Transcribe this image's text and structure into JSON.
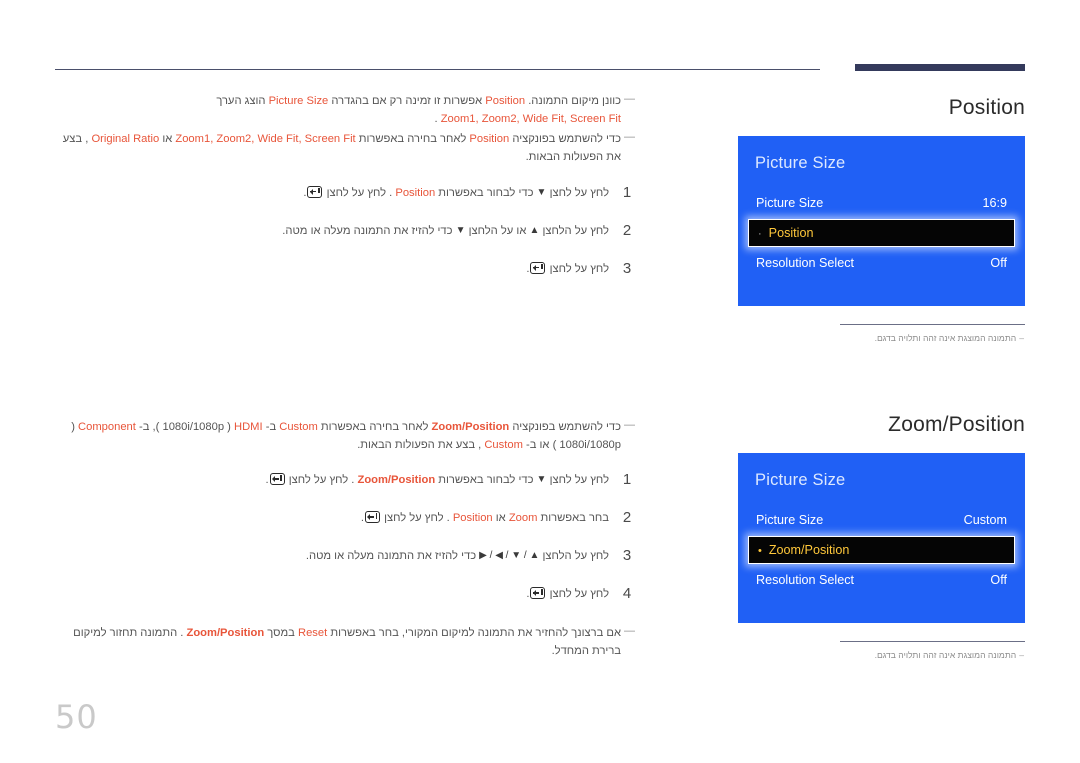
{
  "page": {
    "number": "50"
  },
  "sections": [
    {
      "id": "position",
      "notes": [
        {
          "dash": "—",
          "parts": [
            {
              "t": "כוונן מיקום התמונה.",
              "style": "plain"
            },
            {
              "t": "Position",
              "style": "hl"
            },
            {
              "t": "אפשרות זו זמינה רק אם בהגדרה",
              "style": "plain"
            },
            {
              "t": "Picture Size",
              "style": "hl"
            },
            {
              "t": "הוצג הערך",
              "style": "plain"
            },
            {
              "t": "Zoom1, Zoom2, Wide Fit, Screen Fit",
              "style": "hl"
            },
            {
              "t": ".",
              "style": "plain"
            }
          ]
        },
        {
          "dash": "—",
          "parts": [
            {
              "t": "כדי להשתמש בפונקציה",
              "style": "plain"
            },
            {
              "t": "Position",
              "style": "hl"
            },
            {
              "t": "לאחר בחירה באפשרות",
              "style": "plain"
            },
            {
              "t": "Zoom1, Zoom2, Wide Fit, Screen Fit",
              "style": "hl"
            },
            {
              "t": "או",
              "style": "plain"
            },
            {
              "t": "Original Ratio",
              "style": "hl"
            },
            {
              "t": ", בצע את הפעולות הבאות.",
              "style": "plain"
            }
          ]
        }
      ],
      "steps": [
        {
          "num": "1",
          "parts": [
            {
              "t": "לחץ על לחצן",
              "style": "plain"
            },
            {
              "t": "▼",
              "style": "tri"
            },
            {
              "t": "כדי לבחור באפשרות",
              "style": "plain"
            },
            {
              "t": "Position",
              "style": "hl"
            },
            {
              "t": ". לחץ על לחצן",
              "style": "plain"
            },
            {
              "t": "enter-key",
              "style": "key"
            },
            {
              "t": ".",
              "style": "plain"
            }
          ]
        },
        {
          "num": "2",
          "parts": [
            {
              "t": "לחץ על הלחצן",
              "style": "plain"
            },
            {
              "t": "▲",
              "style": "tri"
            },
            {
              "t": "או על הלחצן",
              "style": "plain"
            },
            {
              "t": "▼",
              "style": "tri"
            },
            {
              "t": "כדי להזיז את התמונה מעלה או מטה.",
              "style": "plain"
            }
          ]
        },
        {
          "num": "3",
          "parts": [
            {
              "t": "לחץ על לחצן",
              "style": "plain"
            },
            {
              "t": "enter-key",
              "style": "key"
            },
            {
              "t": ".",
              "style": "plain"
            }
          ]
        }
      ],
      "osd": {
        "title": "Position",
        "header": "Picture Size",
        "rows": [
          {
            "label": "Picture Size",
            "value": "16:9",
            "selected": false,
            "bullet": ""
          },
          {
            "label": "Position",
            "value": "",
            "selected": true,
            "bullet": "·",
            "bullet_color": "gray"
          },
          {
            "label": "Resolution Select",
            "value": "Off",
            "selected": false,
            "bullet": ""
          }
        ],
        "footnote_dash": "–",
        "footnote": "התמונה המוצגת אינה זהה ותלויה בדגם."
      }
    },
    {
      "id": "zoom-position",
      "notes": [
        {
          "dash": "—",
          "parts": [
            {
              "t": "כדי להשתמש בפונקציה",
              "style": "plain"
            },
            {
              "t": "Zoom/Position",
              "style": "hl-b"
            },
            {
              "t": "לאחר בחירה באפשרות",
              "style": "plain"
            },
            {
              "t": "Custom",
              "style": "hl"
            },
            {
              "t": "ב-",
              "style": "plain"
            },
            {
              "t": "HDMI",
              "style": "hl"
            },
            {
              "t": "( 1080i/1080p ), ב-",
              "style": "plain"
            },
            {
              "t": "Component",
              "style": "hl"
            },
            {
              "t": "( 1080i/1080p ) או ב-",
              "style": "plain"
            },
            {
              "t": "Custom",
              "style": "hl"
            },
            {
              "t": ", בצע את הפעולות הבאות.",
              "style": "plain"
            }
          ]
        }
      ],
      "steps": [
        {
          "num": "1",
          "parts": [
            {
              "t": "לחץ על לחצן",
              "style": "plain"
            },
            {
              "t": "▼",
              "style": "tri"
            },
            {
              "t": "כדי לבחור באפשרות",
              "style": "plain"
            },
            {
              "t": "Zoom/Position",
              "style": "hl-b"
            },
            {
              "t": ". לחץ על לחצן",
              "style": "plain"
            },
            {
              "t": "enter-key",
              "style": "key"
            },
            {
              "t": ".",
              "style": "plain"
            }
          ]
        },
        {
          "num": "2",
          "parts": [
            {
              "t": "בחר באפשרות",
              "style": "plain"
            },
            {
              "t": "Zoom",
              "style": "hl"
            },
            {
              "t": "או",
              "style": "plain"
            },
            {
              "t": "Position",
              "style": "hl"
            },
            {
              "t": ". לחץ על לחצן",
              "style": "plain"
            },
            {
              "t": "enter-key",
              "style": "key"
            },
            {
              "t": ".",
              "style": "plain"
            }
          ]
        },
        {
          "num": "3",
          "parts": [
            {
              "t": "לחץ על הלחצן",
              "style": "plain"
            },
            {
              "t": "▲ / ▼ / ◀ / ▶",
              "style": "tri"
            },
            {
              "t": "כדי להזיז את התמונה מעלה או מטה.",
              "style": "plain"
            }
          ]
        },
        {
          "num": "4",
          "parts": [
            {
              "t": "לחץ על לחצן",
              "style": "plain"
            },
            {
              "t": "enter-key",
              "style": "key"
            },
            {
              "t": ".",
              "style": "plain"
            }
          ]
        }
      ],
      "trailing_note": {
        "dash": "—",
        "parts": [
          {
            "t": "אם ברצונך להחזיר את התמונה למיקום המקורי, בחר באפשרות",
            "style": "plain"
          },
          {
            "t": "Reset",
            "style": "hl"
          },
          {
            "t": "במסך",
            "style": "plain"
          },
          {
            "t": "Zoom/Position",
            "style": "hl-b"
          },
          {
            "t": ". התמונה תחזור למיקום ברירת המחדל.",
            "style": "plain"
          }
        ]
      },
      "osd": {
        "title": "Zoom/Position",
        "header": "Picture Size",
        "rows": [
          {
            "label": "Picture Size",
            "value": "Custom",
            "selected": false,
            "bullet": ""
          },
          {
            "label": "Zoom/Position",
            "value": "",
            "selected": true,
            "bullet": "•",
            "bullet_color": "yellow"
          },
          {
            "label": "Resolution Select",
            "value": "Off",
            "selected": false,
            "bullet": ""
          }
        ],
        "footnote_dash": "–",
        "footnote": "התמונה המוצגת אינה זהה ותלויה בדגם."
      }
    }
  ],
  "colors": {
    "accent_red": "#e8553a",
    "osd_blue": "#2060f5",
    "osd_highlight_text": "#ffc83b",
    "rule_navy": "#343a5c"
  }
}
